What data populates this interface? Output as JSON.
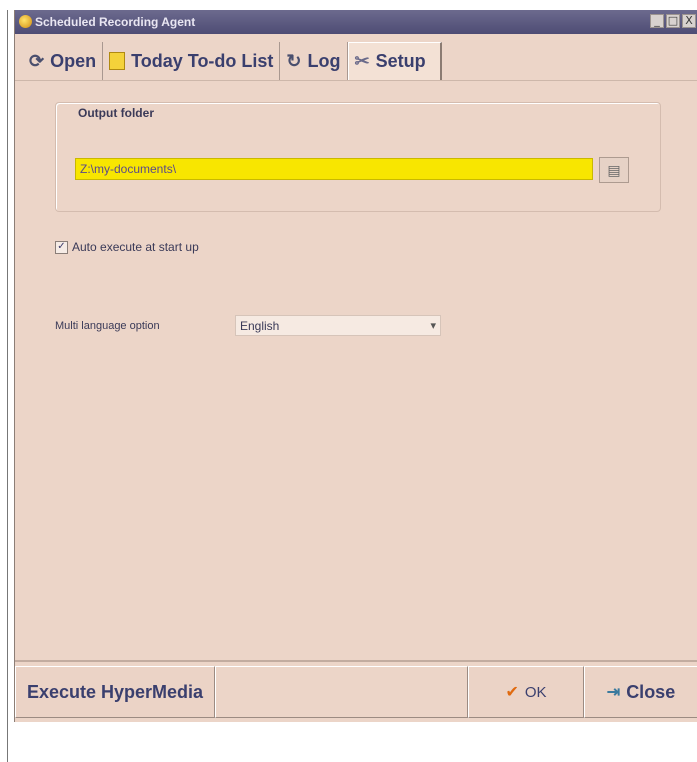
{
  "window": {
    "title": "Scheduled Recording Agent",
    "controls": [
      "_",
      "□",
      "X"
    ]
  },
  "tabs": [
    {
      "label": "Open",
      "icon": "open-icon",
      "active": false
    },
    {
      "label": "Today To-do List",
      "icon": "notepad-icon",
      "active": false
    },
    {
      "label": "Log",
      "icon": "log-icon",
      "active": false
    },
    {
      "label": "Setup",
      "icon": "tools-icon",
      "active": true
    }
  ],
  "setup": {
    "output_folder": {
      "group_title": "Output folder",
      "path_value": "Z:\\my-documents\\",
      "browse_icon": "folder-browse-icon"
    },
    "auto_execute": {
      "checked": true,
      "label": "Auto execute at start up"
    },
    "language": {
      "label": "Multi language option",
      "selected": "English"
    }
  },
  "footer": {
    "execute_label": "Execute HyperMedia",
    "ok_label": "OK",
    "close_label": "Close"
  },
  "colors": {
    "accent_field": "#f8e600",
    "window_bg": "#ecd5c8",
    "text": "#3a3f6e"
  }
}
